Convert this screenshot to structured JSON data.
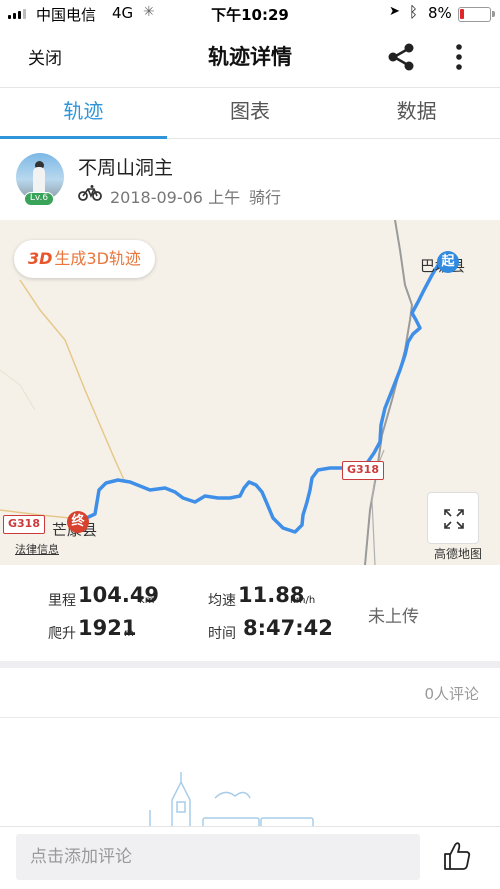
{
  "status_bar": {
    "carrier": "中国电信",
    "network": "4G",
    "time": "下午10:29",
    "battery": "8%",
    "battery_color": "#e0262a"
  },
  "nav": {
    "close_label": "关闭",
    "title": "轨迹详情",
    "share_icon": "share-icon",
    "more_icon": "more-vertical-icon"
  },
  "tabs": [
    {
      "label": "轨迹",
      "active": true
    },
    {
      "label": "图表",
      "active": false
    },
    {
      "label": "数据",
      "active": false
    }
  ],
  "accent_color": "#2f95d8",
  "user": {
    "name": "不周山洞主",
    "level": "Lv.6",
    "date": "2018-09-06 上午",
    "activity": "骑行"
  },
  "map": {
    "btn_3d_prefix": "3D",
    "btn_3d_label": "生成3D轨迹",
    "start_place": "巴塘县",
    "start_marker": "起",
    "end_place": "芒康县",
    "end_marker": "终",
    "road_1": "G318",
    "road_2": "G318",
    "legal": "法律信息",
    "provider": "高德地图",
    "track_color": "#3f8fe8"
  },
  "stats": {
    "distance_label": "里程",
    "distance_value": "104.49",
    "distance_unit": "km",
    "speed_label": "均速",
    "speed_value": "11.88",
    "speed_unit": "km/h",
    "climb_label": "爬升",
    "climb_value": "1921",
    "climb_unit": "m",
    "time_label": "时间",
    "time_value": "8:47:42",
    "upload_status": "未上传"
  },
  "comments": {
    "count_label": "0人评论",
    "placeholder": "点击添加评论"
  }
}
